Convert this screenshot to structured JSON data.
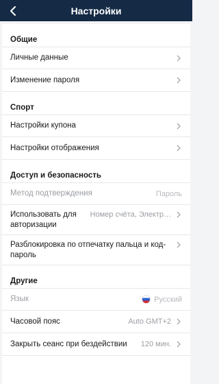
{
  "header": {
    "title": "Настройки"
  },
  "sections": {
    "general": {
      "title": "Общие",
      "items": [
        {
          "label": "Личные данные"
        },
        {
          "label": "Изменение пароля"
        }
      ]
    },
    "sport": {
      "title": "Спорт",
      "items": [
        {
          "label": "Настройки купона"
        },
        {
          "label": "Настройки отображения"
        }
      ]
    },
    "security": {
      "title": "Доступ и безопасность",
      "items": [
        {
          "label": "Метод подтверждения",
          "value": "Пароль"
        },
        {
          "label": "Использовать для авторизации",
          "value": "Номер счёта, Электр…"
        },
        {
          "label": "Разблокировка по отпечатку пальца и код-пароль"
        }
      ]
    },
    "other": {
      "title": "Другие",
      "items": [
        {
          "label": "Язык",
          "value": "Русский"
        },
        {
          "label": "Часовой пояс",
          "value": "Auto GMT+2"
        },
        {
          "label": "Закрыть сеанс при бездействии",
          "value": "120 мин."
        }
      ]
    }
  },
  "colors": {
    "header_bg": "#142a45",
    "page_bg": "#f3f4f6",
    "muted_text": "#9a9da2"
  },
  "icons": {
    "back": "chevron-left-icon",
    "row": "chevron-right-icon",
    "language_flag": "russia-flag-icon"
  }
}
